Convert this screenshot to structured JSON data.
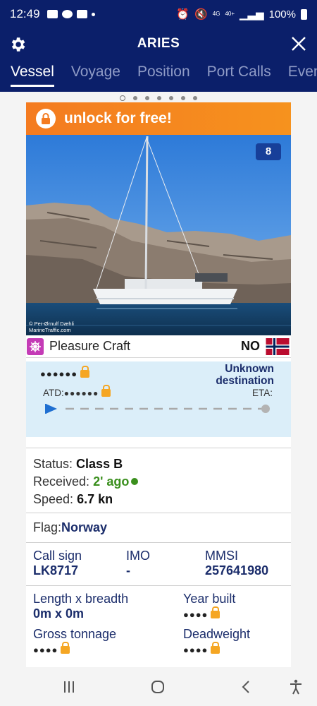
{
  "status_bar": {
    "time": "12:49",
    "battery": "100%",
    "network": "4G",
    "network2": "40+"
  },
  "header": {
    "title": "ARIES",
    "tabs": [
      "Vessel",
      "Voyage",
      "Position",
      "Port Calls",
      "Even"
    ]
  },
  "banner": {
    "text": "unlock for free!"
  },
  "photo": {
    "count": "8",
    "credit_line1": "© Per-Ørnulf Dæhli",
    "credit_line2": "MarineTraffic.com"
  },
  "vessel_type": {
    "label": "Pleasure Craft",
    "flag_code": "NO"
  },
  "voyage": {
    "masked": "●●●●●●",
    "destination": "Unknown destination",
    "atd_label": "ATD:",
    "atd_masked": "●●●●●●",
    "eta_label": "ETA:"
  },
  "details": {
    "status_label": "Status:",
    "status_value": "Class B",
    "received_label": "Received:",
    "received_value": "2' ago",
    "speed_label": "Speed:",
    "speed_value": "6.7 kn"
  },
  "flag": {
    "label": "Flag:",
    "value": "Norway"
  },
  "ids": {
    "callsign_label": "Call sign",
    "callsign_value": "LK8717",
    "imo_label": "IMO",
    "imo_value": "-",
    "mmsi_label": "MMSI",
    "mmsi_value": "257641980"
  },
  "dims": {
    "length_label": "Length x breadth",
    "length_value": "0m x 0m",
    "year_label": "Year built",
    "year_masked": "●●●●",
    "gross_label": "Gross tonnage",
    "gross_masked": "●●●●",
    "dead_label": "Deadweight",
    "dead_masked": "●●●●"
  },
  "colors": {
    "header_bg": "#0b1f6a",
    "banner": "#f47b20",
    "voyage_bg": "#dbeef9",
    "accent": "#1b2d6b"
  }
}
